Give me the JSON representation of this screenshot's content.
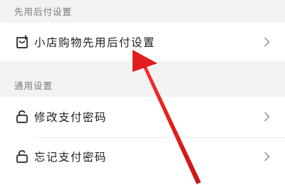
{
  "sections": [
    {
      "label": "先用后付设置",
      "items": [
        {
          "label": "小店购物先用后付设置",
          "icon": "shopping-bag-icon"
        }
      ]
    },
    {
      "label": "通用设置",
      "items": [
        {
          "label": "修改支付密码",
          "icon": "lock-icon"
        },
        {
          "label": "忘记支付密码",
          "icon": "lock-icon"
        }
      ]
    }
  ],
  "colors": {
    "page_bg": "#f2f2f2",
    "card_bg": "#ffffff",
    "section_text": "#7a7a7a",
    "arrow_annotation": "#e02020"
  }
}
